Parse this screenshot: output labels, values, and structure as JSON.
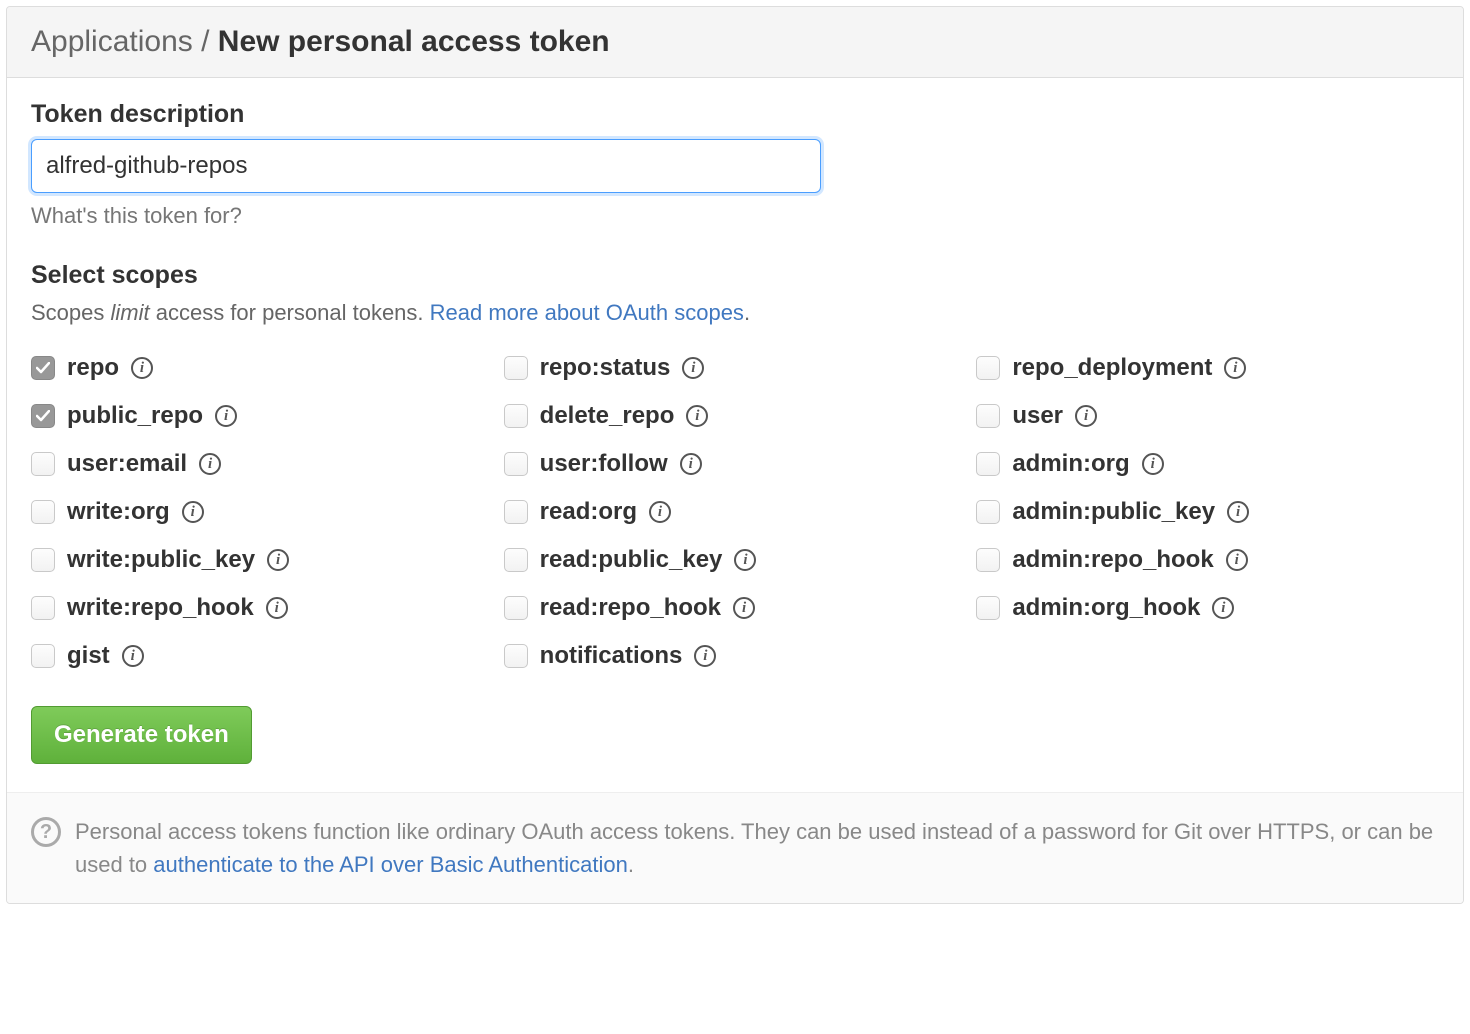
{
  "header": {
    "breadcrumb": "Applications",
    "separator": " / ",
    "title": "New personal access token"
  },
  "description": {
    "label": "Token description",
    "value": "alfred-github-repos",
    "hint": "What's this token for?"
  },
  "scopes": {
    "label": "Select scopes",
    "desc_pre": "Scopes ",
    "desc_em": "limit",
    "desc_post": " access for personal tokens. ",
    "link_text": "Read more about OAuth scopes",
    "items": [
      {
        "name": "repo",
        "checked": true
      },
      {
        "name": "repo:status",
        "checked": false
      },
      {
        "name": "repo_deployment",
        "checked": false
      },
      {
        "name": "public_repo",
        "checked": true
      },
      {
        "name": "delete_repo",
        "checked": false
      },
      {
        "name": "user",
        "checked": false
      },
      {
        "name": "user:email",
        "checked": false
      },
      {
        "name": "user:follow",
        "checked": false
      },
      {
        "name": "admin:org",
        "checked": false
      },
      {
        "name": "write:org",
        "checked": false
      },
      {
        "name": "read:org",
        "checked": false
      },
      {
        "name": "admin:public_key",
        "checked": false
      },
      {
        "name": "write:public_key",
        "checked": false
      },
      {
        "name": "read:public_key",
        "checked": false
      },
      {
        "name": "admin:repo_hook",
        "checked": false
      },
      {
        "name": "write:repo_hook",
        "checked": false
      },
      {
        "name": "read:repo_hook",
        "checked": false
      },
      {
        "name": "admin:org_hook",
        "checked": false
      },
      {
        "name": "gist",
        "checked": false
      },
      {
        "name": "notifications",
        "checked": false
      }
    ]
  },
  "actions": {
    "generate": "Generate token"
  },
  "footer": {
    "text_pre": "Personal access tokens function like ordinary OAuth access tokens. They can be used instead of a password for Git over HTTPS, or can be used to ",
    "link_text": "authenticate to the API over Basic Authentication",
    "text_post": "."
  }
}
